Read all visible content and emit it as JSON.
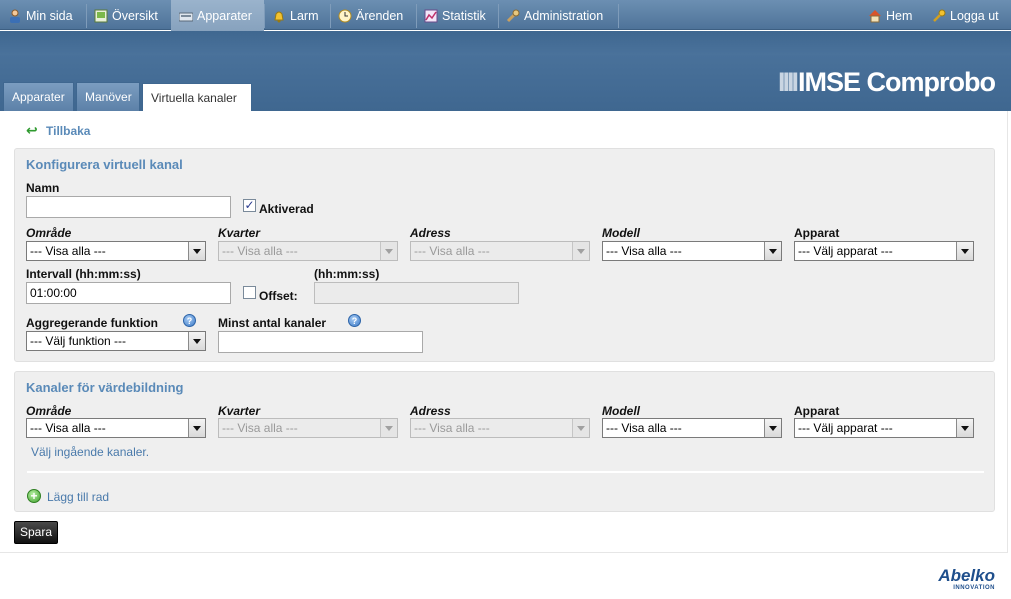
{
  "topnav": {
    "items": [
      {
        "label": "Min sida",
        "icon": "user-icon"
      },
      {
        "label": "Översikt",
        "icon": "overview-icon"
      },
      {
        "label": "Apparater",
        "icon": "device-icon"
      },
      {
        "label": "Larm",
        "icon": "alarm-bell-icon"
      },
      {
        "label": "Ärenden",
        "icon": "clock-icon"
      },
      {
        "label": "Statistik",
        "icon": "chart-icon"
      },
      {
        "label": "Administration",
        "icon": "wrench-icon"
      }
    ],
    "active": "Apparater",
    "right": [
      {
        "label": "Hem",
        "icon": "home-icon"
      },
      {
        "label": "Logga ut",
        "icon": "key-icon"
      }
    ]
  },
  "brand": {
    "bars": "IIII",
    "name": "IMSE Comprobo"
  },
  "tabs": [
    {
      "label": "Apparater"
    },
    {
      "label": "Manöver"
    },
    {
      "label": "Virtuella kanaler"
    }
  ],
  "back_link": "Tillbaka",
  "config_panel": {
    "title": "Konfigurera virtuell kanal",
    "name_label": "Namn",
    "name_value": "",
    "activated_label": "Aktiverad",
    "activated_checked": true,
    "filters": [
      {
        "label": "Område",
        "value": "--- Visa alla ---",
        "disabled": false
      },
      {
        "label": "Kvarter",
        "value": "--- Visa alla ---",
        "disabled": true
      },
      {
        "label": "Adress",
        "value": "--- Visa alla ---",
        "disabled": true
      },
      {
        "label": "Modell",
        "value": "--- Visa alla ---",
        "disabled": false
      },
      {
        "label": "Apparat",
        "value": "--- Välj apparat ---",
        "disabled": false
      }
    ],
    "interval_label": "Intervall (hh:mm:ss)",
    "interval_value": "01:00:00",
    "offset_label": "Offset:",
    "offset_format_label": "(hh:mm:ss)",
    "offset_value": "",
    "agg_label": "Aggregerande funktion",
    "agg_value": "--- Välj funktion ---",
    "min_channels_label": "Minst antal kanaler",
    "min_channels_value": ""
  },
  "channels_panel": {
    "title": "Kanaler för värdebildning",
    "filters": [
      {
        "label": "Område",
        "value": "--- Visa alla ---",
        "disabled": false
      },
      {
        "label": "Kvarter",
        "value": "--- Visa alla ---",
        "disabled": true
      },
      {
        "label": "Adress",
        "value": "--- Visa alla ---",
        "disabled": true
      },
      {
        "label": "Modell",
        "value": "--- Visa alla ---",
        "disabled": false
      },
      {
        "label": "Apparat",
        "value": "--- Välj apparat ---",
        "disabled": false
      }
    ],
    "hint": "Välj ingående kanaler.",
    "add_row": "Lägg till rad"
  },
  "save_label": "Spara",
  "footer": {
    "brand": "Abelko",
    "tagline": "INNOVATION"
  },
  "colors": {
    "nav": "#5b7fa6",
    "header": "#466e97",
    "link": "#5a8ab8",
    "panel": "#efefef"
  }
}
